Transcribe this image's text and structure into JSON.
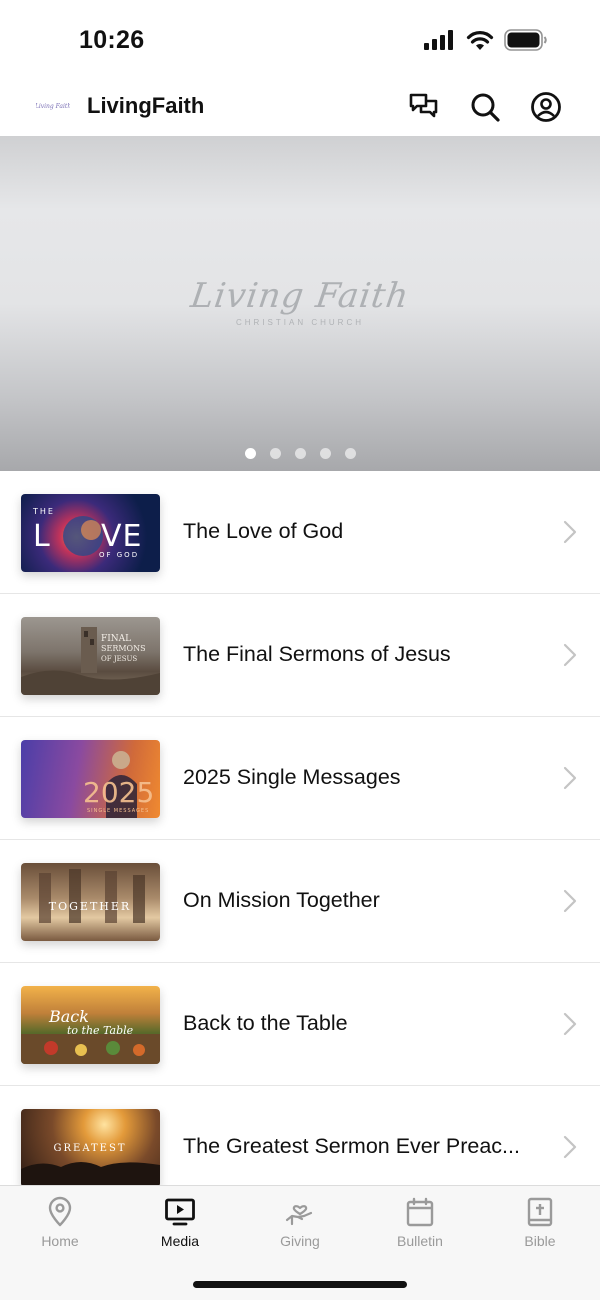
{
  "status_bar": {
    "time": "10:26"
  },
  "header": {
    "title": "LivingFaith",
    "logo_text": "Living Faith"
  },
  "hero": {
    "logo_script": "Living Faith",
    "logo_sub": "CHRISTIAN CHURCH",
    "slide_count": 5,
    "active_slide": 1
  },
  "media_items": [
    {
      "title": "The Love of God",
      "thumb_text": "THE LOVE OF GOD"
    },
    {
      "title": "The Final Sermons of Jesus",
      "thumb_text": "THE FINAL SERMONS OF JESUS"
    },
    {
      "title": "2025 Single Messages",
      "thumb_text": "2025"
    },
    {
      "title": "On Mission Together",
      "thumb_text": "TOGETHER"
    },
    {
      "title": "Back to the Table",
      "thumb_text": "Back to the Table"
    },
    {
      "title": "The Greatest Sermon Ever Preac...",
      "thumb_text": "THE GREATEST"
    }
  ],
  "tabs": [
    {
      "label": "Home",
      "icon": "map-pin-icon"
    },
    {
      "label": "Media",
      "icon": "tv-play-icon"
    },
    {
      "label": "Giving",
      "icon": "hand-heart-icon"
    },
    {
      "label": "Bulletin",
      "icon": "calendar-icon"
    },
    {
      "label": "Bible",
      "icon": "bible-icon"
    }
  ],
  "active_tab": "Media",
  "colors": {
    "text": "#111111",
    "tab_inactive": "#9a9a9a",
    "divider": "#e6e6e6"
  }
}
